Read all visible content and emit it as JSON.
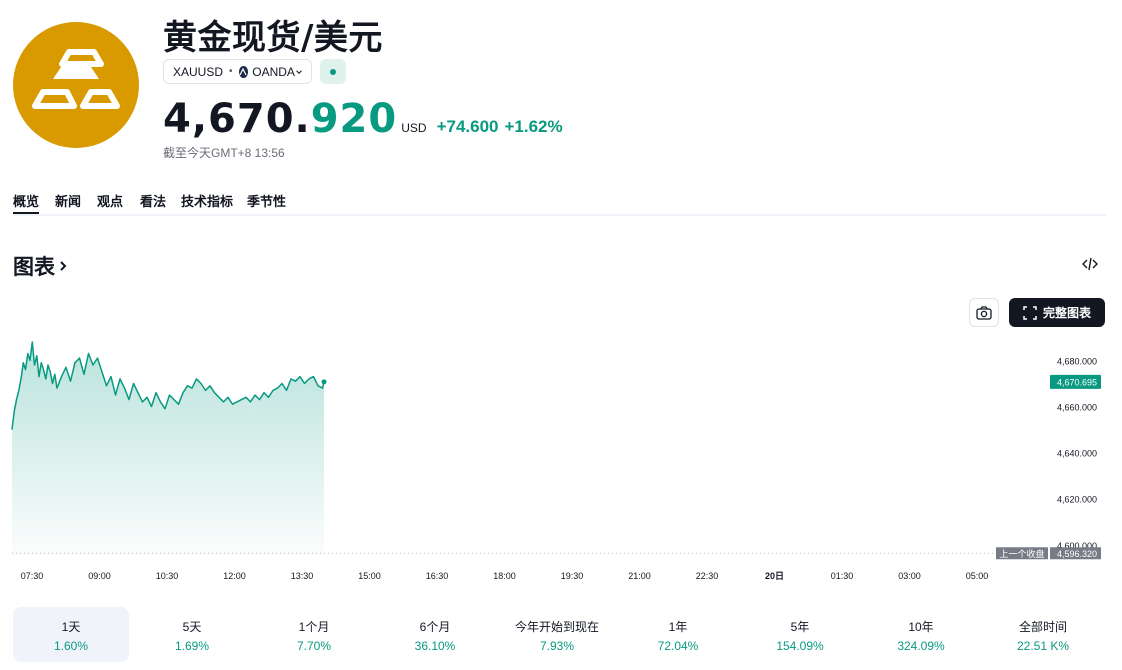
{
  "header": {
    "title": "黄金现货/美元",
    "symbol": "XAUUSD",
    "separator": "•",
    "exchange": "OANDA",
    "price_main": "4,670.",
    "price_tail": "920",
    "currency": "USD",
    "change_abs": "+74.600",
    "change_pct": "+1.62%",
    "as_of": "截至今天GMT+8 13:56",
    "logo_icon": "gold-bars-icon",
    "status_color": "#089981"
  },
  "tabs": [
    "概览",
    "新闻",
    "观点",
    "看法",
    "技术指标",
    "季节性"
  ],
  "active_tab": "概览",
  "chart_section": {
    "title": "图表",
    "full_chart_label": "完整图表",
    "camera_icon": "camera-icon",
    "embed_icon": "embed-code-icon",
    "fullscreen_icon": "fullscreen-icon"
  },
  "chart_data": {
    "type": "area",
    "title": "",
    "xlabel": "",
    "ylabel": "",
    "x_ticks": [
      "07:30",
      "09:00",
      "10:30",
      "12:00",
      "13:30",
      "15:00",
      "16:30",
      "18:00",
      "19:30",
      "21:00",
      "22:30",
      "20日",
      "01:30",
      "03:00",
      "05:00"
    ],
    "y_ticks": [
      "4,600.000",
      "4,620.000",
      "4,640.000",
      "4,660.000",
      "4,680.000"
    ],
    "ylim": [
      4596,
      4688
    ],
    "last_price_label": "4,670.695",
    "last_price": 4670.695,
    "prev_close_label": "上一个收盘",
    "prev_close_value_label": "4,596.320",
    "prev_close": 4596.32,
    "line_color": "#089981",
    "x_start": "07:00",
    "x_end": "13:56",
    "series": [
      {
        "x": [
          "07:00",
          "07:03",
          "07:06",
          "07:09",
          "07:12",
          "07:15",
          "07:18",
          "07:21",
          "07:24",
          "07:27",
          "07:30",
          "07:33",
          "07:36",
          "07:39",
          "07:42",
          "07:45",
          "07:48",
          "07:51",
          "07:54",
          "07:57",
          "08:00",
          "08:06",
          "08:12",
          "08:18",
          "08:24",
          "08:30",
          "08:36",
          "08:42",
          "08:48",
          "08:54",
          "09:00",
          "09:06",
          "09:12",
          "09:18",
          "09:24",
          "09:30",
          "09:36",
          "09:42",
          "09:48",
          "09:54",
          "10:00",
          "10:06",
          "10:12",
          "10:18",
          "10:24",
          "10:30",
          "10:36",
          "10:42",
          "10:48",
          "10:54",
          "11:00",
          "11:06",
          "11:12",
          "11:18",
          "11:24",
          "11:30",
          "11:36",
          "11:42",
          "11:48",
          "11:54",
          "12:00",
          "12:06",
          "12:12",
          "12:18",
          "12:24",
          "12:30",
          "12:36",
          "12:42",
          "12:48",
          "12:54",
          "13:00",
          "13:06",
          "13:12",
          "13:18",
          "13:24",
          "13:30",
          "13:36",
          "13:42",
          "13:48",
          "13:54",
          "13:56"
        ],
        "values": [
          4650,
          4658,
          4663,
          4667,
          4672,
          4679,
          4676,
          4683,
          4680,
          4688,
          4678,
          4682,
          4673,
          4679,
          4676,
          4672,
          4678,
          4675,
          4670,
          4674,
          4668,
          4673,
          4677,
          4671,
          4679,
          4681,
          4674,
          4683,
          4678,
          4681,
          4675,
          4669,
          4673,
          4665,
          4672,
          4668,
          4663,
          4670,
          4666,
          4662,
          4664,
          4660,
          4666,
          4662,
          4659,
          4665,
          4663,
          4661,
          4666,
          4669,
          4668,
          4672,
          4670,
          4667,
          4669,
          4666,
          4664,
          4662,
          4664,
          4661,
          4662,
          4663,
          4664,
          4662,
          4665,
          4663,
          4666,
          4664,
          4667,
          4668,
          4670,
          4667,
          4672,
          4671,
          4673,
          4670,
          4672,
          4673,
          4669,
          4668,
          4670.7
        ]
      }
    ]
  },
  "periods": [
    {
      "label": "1天",
      "value": "1.60%"
    },
    {
      "label": "5天",
      "value": "1.69%"
    },
    {
      "label": "1个月",
      "value": "7.70%"
    },
    {
      "label": "6个月",
      "value": "36.10%"
    },
    {
      "label": "今年开始到现在",
      "value": "7.93%"
    },
    {
      "label": "1年",
      "value": "72.04%"
    },
    {
      "label": "5年",
      "value": "154.09%"
    },
    {
      "label": "10年",
      "value": "324.09%"
    },
    {
      "label": "全部时间",
      "value": "22.51 K%"
    }
  ],
  "active_period": "1天"
}
